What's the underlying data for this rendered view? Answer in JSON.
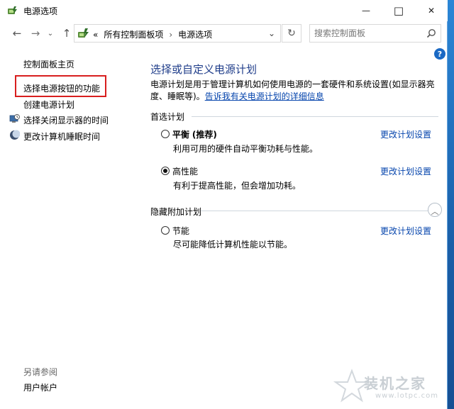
{
  "window": {
    "title": "电源选项",
    "minimize_glyph": "—",
    "maximize_glyph": "□",
    "close_glyph": "✕"
  },
  "nav": {
    "back_glyph": "←",
    "forward_glyph": "→",
    "recent_glyph": "⌄",
    "up_glyph": "↑",
    "breadcrumb_prefix": "«",
    "breadcrumb": [
      "所有控制面板项",
      "电源选项"
    ],
    "breadcrumb_separator": "›",
    "dropdown_glyph": "⌄",
    "refresh_glyph": "↻",
    "search_placeholder": "搜索控制面板"
  },
  "sidebar": {
    "home": "控制面板主页",
    "items": [
      {
        "label": "选择电源按钮的功能",
        "icon": null
      },
      {
        "label": "创建电源计划",
        "icon": null
      },
      {
        "label": "选择关闭显示器的时间",
        "icon": "monitor-clock-icon"
      },
      {
        "label": "更改计算机睡眠时间",
        "icon": "moon-icon"
      }
    ],
    "see_also": "另请参阅",
    "see_also_items": [
      "用户帐户"
    ]
  },
  "main": {
    "title": "选择或自定义电源计划",
    "description": "电源计划是用于管理计算机如何使用电源的一套硬件和系统设置(如显示器亮度、睡眠等)。",
    "description_link": "告诉我有关电源计划的详细信息",
    "preferred_group": "首选计划",
    "hidden_group": "隐藏附加计划",
    "collapse_glyph": "︿",
    "plans": [
      {
        "name": "平衡",
        "tag": "(推荐)",
        "desc": "利用可用的硬件自动平衡功耗与性能。",
        "selected": false,
        "link": "更改计划设置"
      },
      {
        "name": "高性能",
        "tag": "",
        "desc": "有利于提高性能，但会增加功耗。",
        "selected": true,
        "link": "更改计划设置"
      },
      {
        "name": "节能",
        "tag": "",
        "desc": "尽可能降低计算机性能以节能。",
        "selected": false,
        "link": "更改计划设置"
      }
    ]
  },
  "help_glyph": "?",
  "watermark": {
    "text": "装机之家",
    "url": "www.lotpc.com"
  },
  "colors": {
    "highlight": "#d81e1e",
    "title_blue": "#1f3d8a",
    "link_blue": "#0645ad",
    "desktop": "#1f6fb8"
  }
}
